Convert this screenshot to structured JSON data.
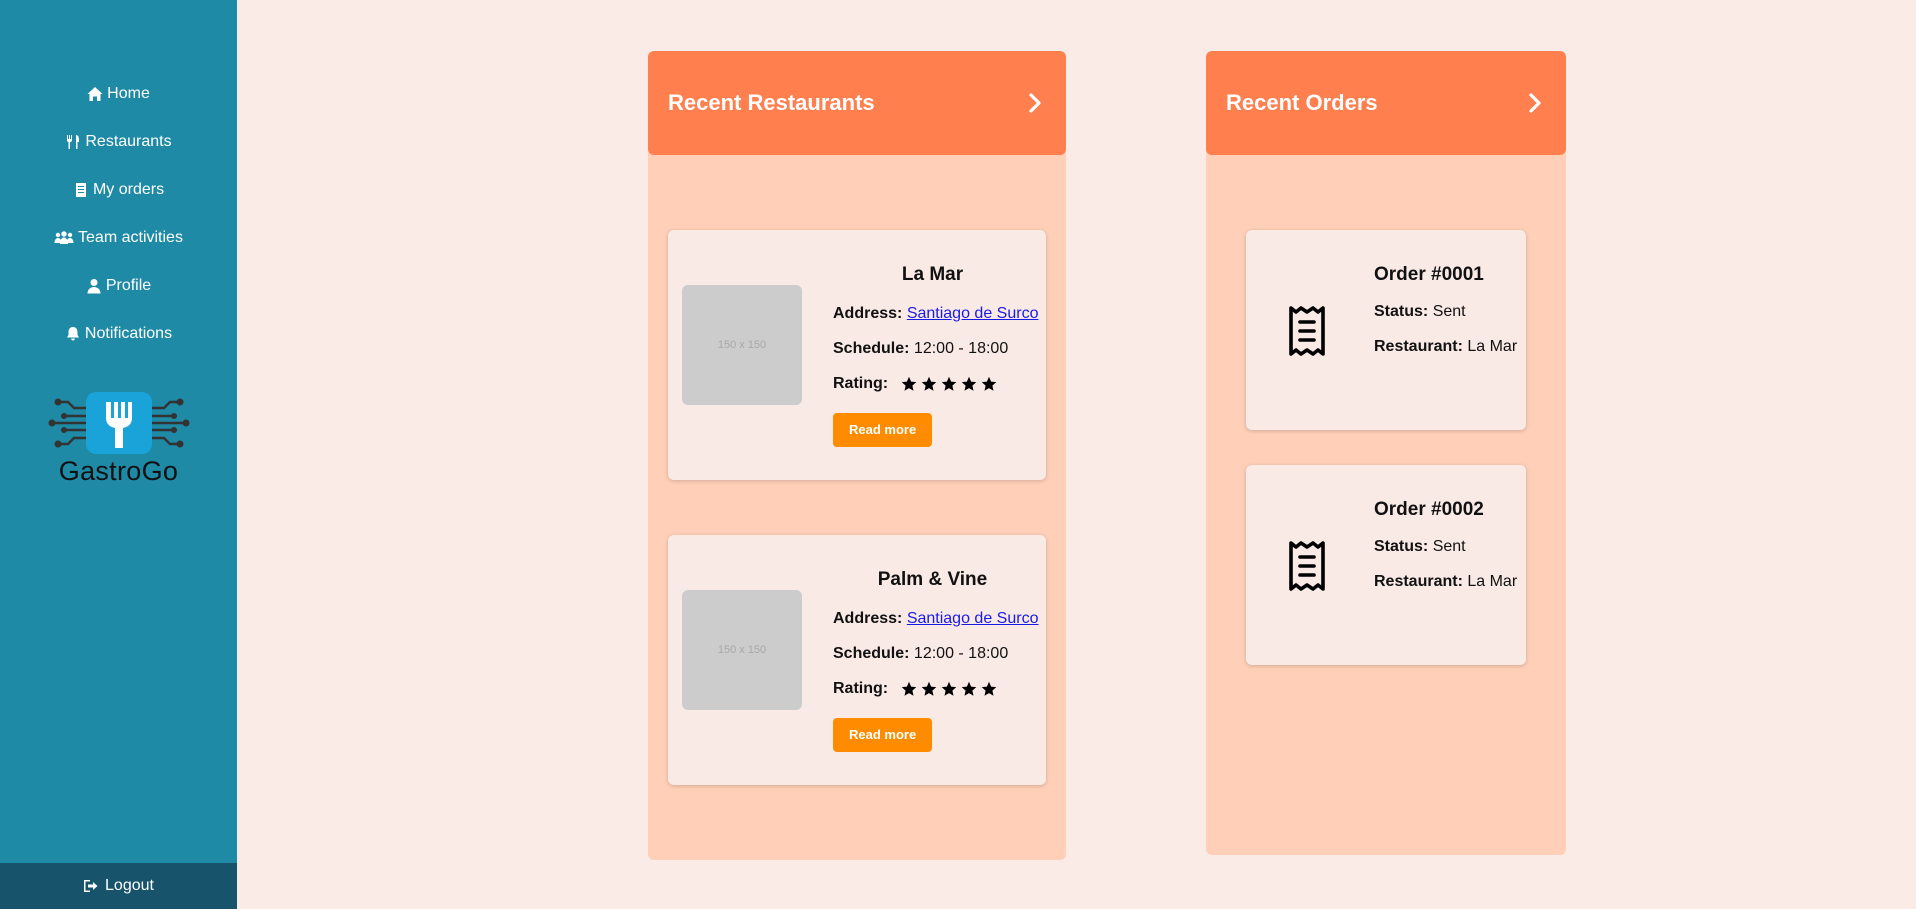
{
  "sidebar": {
    "items": [
      {
        "label": "Home",
        "icon": "home-icon"
      },
      {
        "label": "Restaurants",
        "icon": "utensils-icon"
      },
      {
        "label": "My orders",
        "icon": "clipboard-icon"
      },
      {
        "label": "Team activities",
        "icon": "team-icon"
      },
      {
        "label": "Profile",
        "icon": "user-icon"
      },
      {
        "label": "Notifications",
        "icon": "bell-icon"
      }
    ],
    "logo_text": "GastroGo",
    "logout_label": "Logout"
  },
  "restaurants_panel": {
    "title": "Recent Restaurants",
    "cards": [
      {
        "name": "La Mar",
        "thumb_text": "150 x 150",
        "address_label": "Address:",
        "address": "Santiago de Surco",
        "schedule_label": "Schedule:",
        "schedule": "12:00 - 18:00",
        "rating_label": "Rating:",
        "rating": 5,
        "button": "Read more"
      },
      {
        "name": "Palm & Vine",
        "thumb_text": "150 x 150",
        "address_label": "Address:",
        "address": "Santiago de Surco",
        "schedule_label": "Schedule:",
        "schedule": "12:00 - 18:00",
        "rating_label": "Rating:",
        "rating": 5,
        "button": "Read more"
      }
    ]
  },
  "orders_panel": {
    "title": "Recent Orders",
    "orders": [
      {
        "title": "Order #0001",
        "status_label": "Status:",
        "status": "Sent",
        "restaurant_label": "Restaurant:",
        "restaurant": "La Mar"
      },
      {
        "title": "Order #0002",
        "status_label": "Status:",
        "status": "Sent",
        "restaurant_label": "Restaurant:",
        "restaurant": "La Mar"
      }
    ]
  },
  "colors": {
    "sidebar": "#1e8aa6",
    "sidebar_footer": "#17536b",
    "page_bg": "#faebe7",
    "panel_header": "#ff7f4f",
    "panel_body": "#ffcfb7",
    "button": "#ff8c00"
  }
}
